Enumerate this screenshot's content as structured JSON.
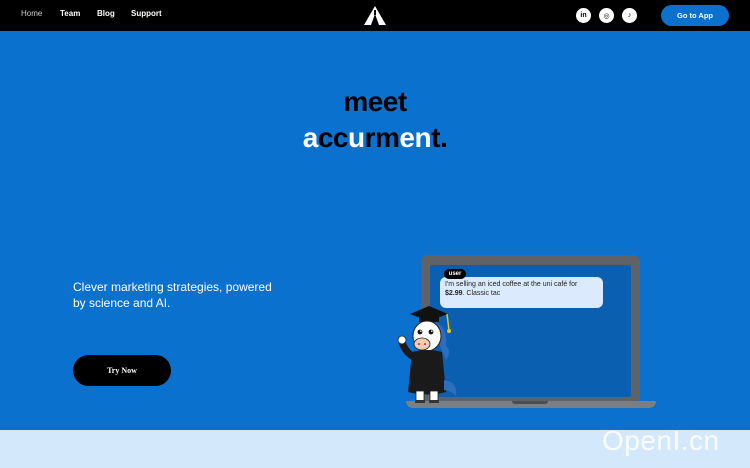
{
  "nav": {
    "links": [
      "Home",
      "Team",
      "Blog",
      "Support"
    ],
    "socials": [
      "in",
      "◎",
      "♪"
    ],
    "cta": "Go to App"
  },
  "hero": {
    "line1": "meet",
    "brand_parts": [
      {
        "text": "a",
        "color": "#ffffff"
      },
      {
        "text": "cc",
        "color": "#000000"
      },
      {
        "text": "u",
        "color": "#ffffff"
      },
      {
        "text": "rm",
        "color": "#000000"
      },
      {
        "text": "en",
        "color": "#ffffff"
      },
      {
        "text": "t",
        "color": "#000000"
      },
      {
        "text": ".",
        "color": "#000000"
      }
    ],
    "tagline": "Clever marketing strategies, powered by science and AI.",
    "button": "Try Now"
  },
  "chat": {
    "role": "user",
    "text_before_price": "I'm selling an iced coffee at the uni café for",
    "price": "$2.99",
    "text_after_price": ". Classic tac"
  },
  "watermark": "OpenI.cn",
  "colors": {
    "background": "#0a71cf",
    "topbar": "#000000",
    "bottom_strip": "#d3e9fb"
  }
}
